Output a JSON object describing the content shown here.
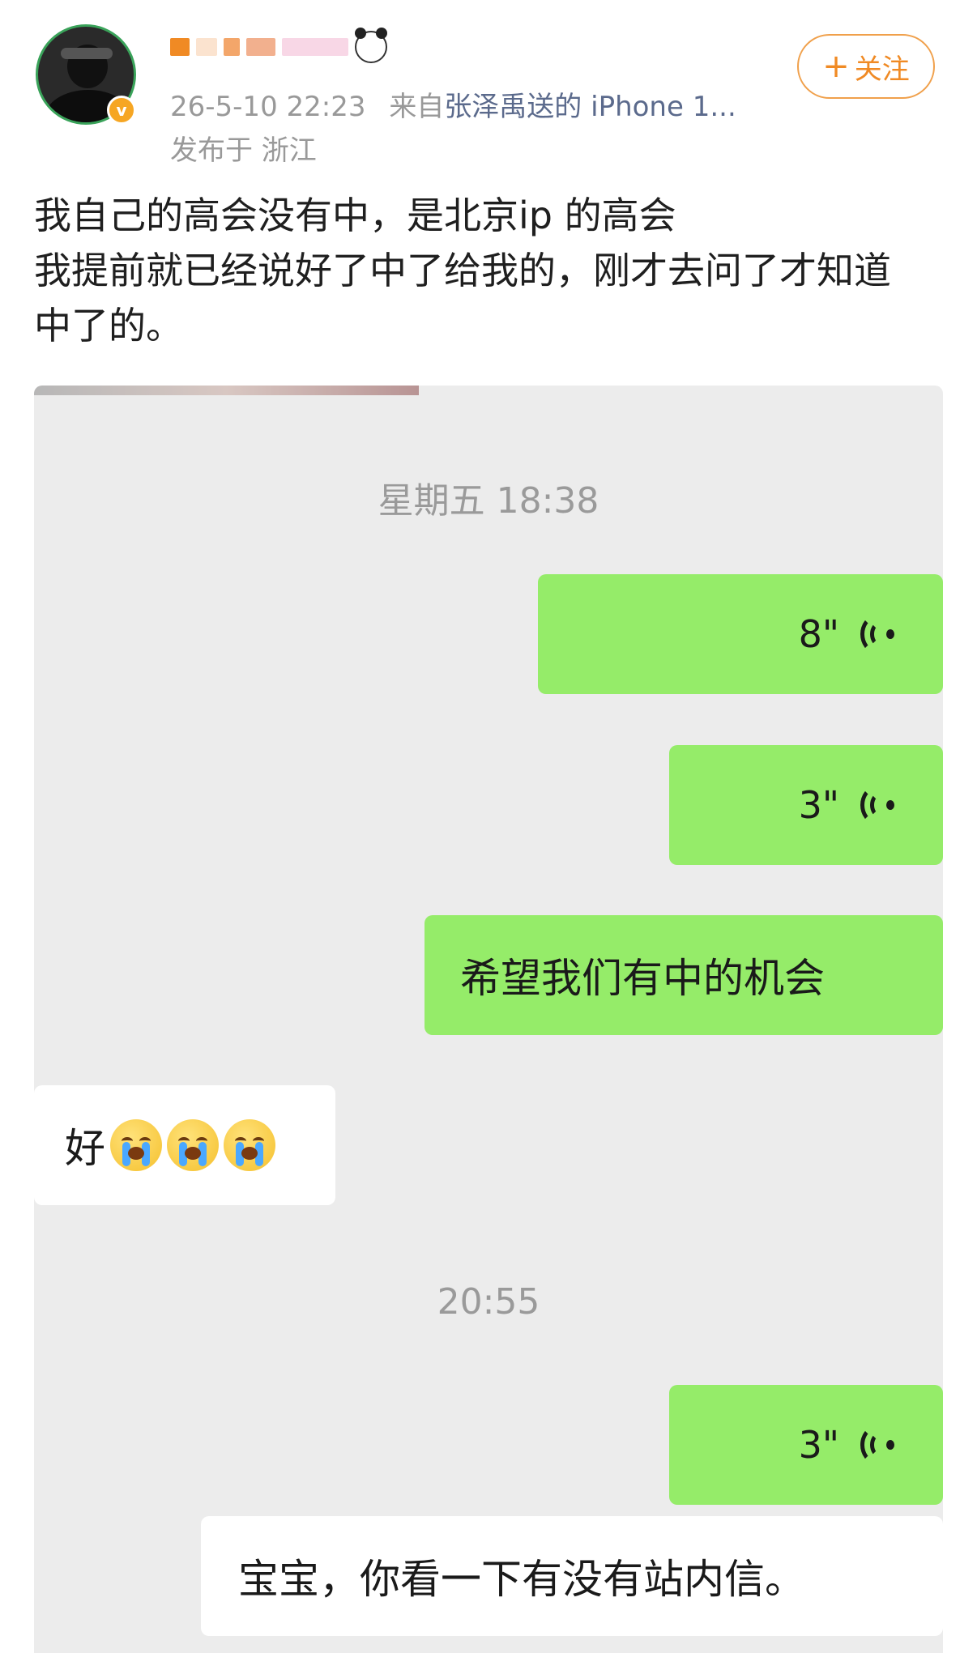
{
  "post": {
    "username_emoji": "panda-emoji",
    "date": "26-5-10 22:23",
    "source_prefix": "来自",
    "source": "张泽禹送的 iPhone 1...",
    "ip_location": "发布于 浙江",
    "follow_label": "关注",
    "follow_plus": "+",
    "verified_badge": "v",
    "text_lines": [
      "我自己的高会没有中，是北京ip 的高会",
      "我提前就已经说好了中了给我的，刚才去问了才知道",
      "中了的。"
    ]
  },
  "chat": {
    "timestamp_1": "星期五 18:38",
    "voice_1": "8\"",
    "voice_2": "3\"",
    "message_1": "希望我们有中的机会",
    "reply_1": "好",
    "reply_1_emojis": [
      "crying-emoji",
      "crying-emoji",
      "crying-emoji"
    ],
    "timestamp_2": "20:55",
    "voice_3": "3\"",
    "message_2": "宝宝，你看一下有没有站内信。"
  },
  "colors": {
    "sent_bubble": "#95ec69",
    "received_bubble": "#ffffff",
    "chat_background": "#ececec",
    "follow_accent": "#f08a24",
    "source_link": "#5b6a8c"
  }
}
